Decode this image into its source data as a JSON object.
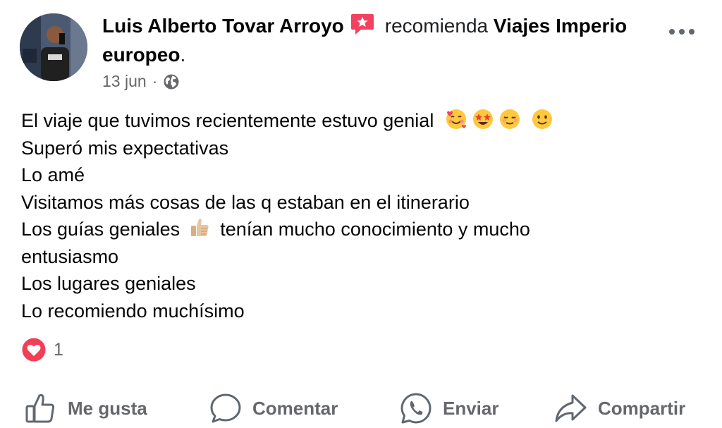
{
  "post": {
    "author": "Luis Alberto Tovar Arroyo",
    "verb": "recomienda",
    "page_name": "Viajes Imperio europeo",
    "page_suffix": ".",
    "date": "13 jun",
    "separator": "·",
    "privacy_icon": "globe-icon",
    "recommend_icon": "star-chat-icon",
    "body_lines": [
      "El viaje que tuvimos recientemente estuvo genial",
      "Superó mis expectativas",
      "Lo amé",
      "Visitamos más cosas de las q estaban en el itinerario",
      "Los guías geniales",
      "tenían mucho conocimiento y mucho",
      "entusiasmo",
      "Los lugares geniales",
      "Lo recomiendo muchísimo"
    ],
    "emojis": [
      "smiling-face-with-hearts",
      "star-struck",
      "smiling-face-blushing",
      "slightly-smiling-face",
      "thumbs-up-light-skin"
    ]
  },
  "reactions": {
    "icon": "love-icon",
    "count": "1"
  },
  "actions": {
    "like_label": "Me gusta",
    "comment_label": "Comentar",
    "send_label": "Enviar",
    "share_label": "Compartir"
  },
  "colors": {
    "text": "#050505",
    "secondary": "#65676b",
    "love": "#f33e58",
    "recommend": "#f3425f"
  }
}
